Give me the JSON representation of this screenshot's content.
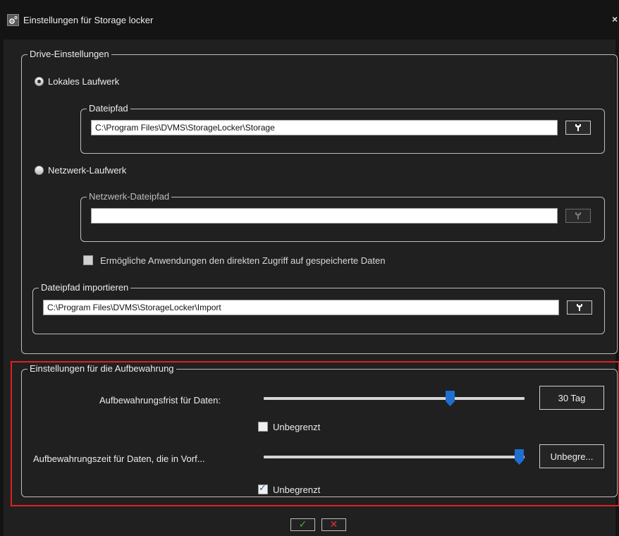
{
  "window": {
    "title": "Einstellungen für Storage locker",
    "icon": "settings-gear-icon",
    "close_glyph": "×"
  },
  "drive_settings": {
    "legend": "Drive-Einstellungen",
    "local_drive": {
      "label": "Lokales Laufwerk",
      "selected": true,
      "file_path_legend": "Dateipfad",
      "file_path_value": "C:\\Program Files\\DVMS\\StorageLocker\\Storage",
      "browse_icon": "wrench-icon"
    },
    "network_drive": {
      "label": "Netzwerk-Laufwerk",
      "selected": false,
      "file_path_legend": "Netzwerk-Dateipfad",
      "file_path_value": "",
      "browse_icon": "wrench-icon",
      "browse_enabled": false
    },
    "direct_access": {
      "label": "Ermögliche Anwendungen den direkten Zugriff auf gespeicherte Daten",
      "checked": false,
      "enabled": false
    },
    "import_path": {
      "legend": "Dateipfad importieren",
      "value": "C:\\Program Files\\DVMS\\StorageLocker\\Import",
      "browse_icon": "wrench-icon"
    }
  },
  "retention_settings": {
    "legend": "Einstellungen für die Aufbewahrung",
    "highlight_color": "#e0201e",
    "data_retention": {
      "label": "Aufbewahrungsfrist für Daten:",
      "slider_fraction": 0.72,
      "value": "30 Tag",
      "unlimited_label": "Unbegrenzt",
      "unlimited_checked": false
    },
    "event_retention": {
      "label": "Aufbewahrungszeit für Daten, die in Vorf...",
      "slider_fraction": 1.0,
      "value": "Unbegre...",
      "unlimited_label": "Unbegrenzt",
      "unlimited_checked": true
    }
  },
  "footer": {
    "ok_glyph": "✓",
    "ok_color": "#3cb43c",
    "cancel_glyph": "✕",
    "cancel_color": "#e03030"
  },
  "colors": {
    "slider_thumb": "#1f6fd0",
    "background": "#202020"
  }
}
